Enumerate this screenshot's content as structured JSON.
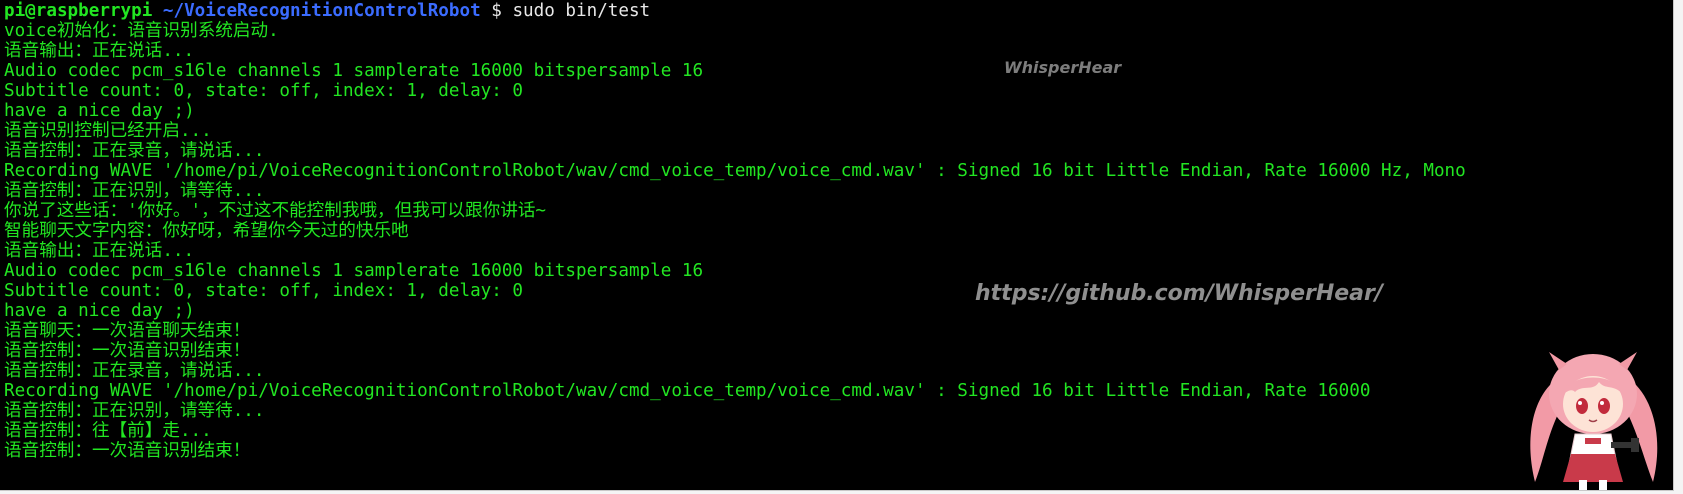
{
  "terminal": {
    "prompt": {
      "user_host": "pi@raspberrypi",
      "path": "~/VoiceRecognitionControlRobot",
      "symbol": "$",
      "command": "sudo bin/test"
    },
    "lines": [
      "voice初始化：语音识别系统启动.",
      "语音输出：正在说话...",
      "Audio codec pcm_s16le channels 1 samplerate 16000 bitspersample 16",
      "Subtitle count: 0, state: off, index: 1, delay: 0",
      "have a nice day ;)",
      "语音识别控制已经开启...",
      "语音控制：正在录音，请说话...",
      "Recording WAVE '/home/pi/VoiceRecognitionControlRobot/wav/cmd_voice_temp/voice_cmd.wav' : Signed 16 bit Little Endian, Rate 16000 Hz, Mono",
      "语音控制：正在识别，请等待...",
      "你说了这些话：'你好。'，不过这不能控制我哦，但我可以跟你讲话~",
      "智能聊天文字内容：你好呀，希望你今天过的快乐吔",
      "语音输出：正在说话...",
      "Audio codec pcm_s16le channels 1 samplerate 16000 bitspersample 16",
      "Subtitle count: 0, state: off, index: 1, delay: 0",
      "have a nice day ;)",
      "语音聊天：一次语音聊天结束！",
      "语音控制：一次语音识别结束！",
      "语音控制：正在录音，请说话...",
      "Recording WAVE '/home/pi/VoiceRecognitionControlRobot/wav/cmd_voice_temp/voice_cmd.wav' : Signed 16 bit Little Endian, Rate 16000",
      "语音控制：正在识别，请等待...",
      "语音控制：往【前】走...",
      "语音控制：一次语音识别结束！"
    ]
  },
  "watermarks": {
    "top": "WhisperHear",
    "url": "https://github.com/WhisperHear/"
  },
  "colors": {
    "background": "#000000",
    "text": "#22e622",
    "path": "#3b6cff",
    "command": "#e8e8e8"
  },
  "icons": {
    "mascot": "anime-girl-mascot"
  }
}
